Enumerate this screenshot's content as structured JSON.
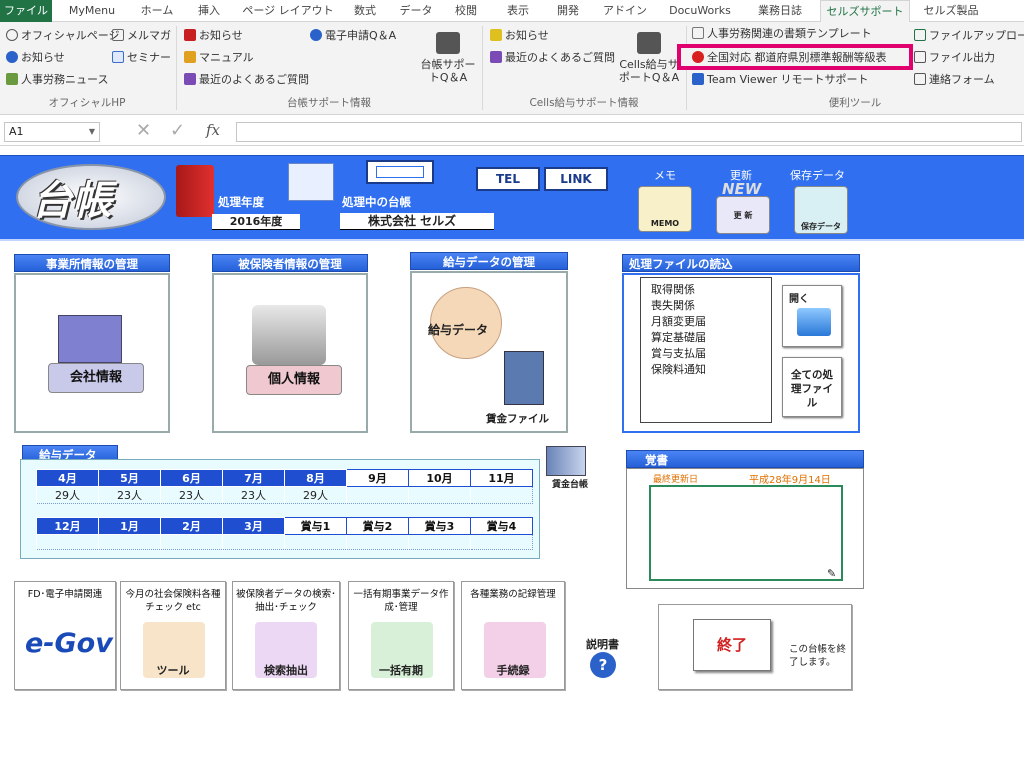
{
  "ribbon": {
    "tabs": [
      "ファイル",
      "MyMenu",
      "ホーム",
      "挿入",
      "ページ レイアウト",
      "数式",
      "データ",
      "校閲",
      "表示",
      "開発",
      "アドイン",
      "DocuWorks",
      "業務日誌",
      "セルズサポート",
      "セルズ製品"
    ],
    "official": {
      "items": [
        "オフィシャルページ",
        "お知らせ",
        "人事労務ニュース",
        "メルマガ",
        "セミナー"
      ],
      "group": "オフィシャルHP"
    },
    "daicho_support": {
      "items": [
        "お知らせ",
        "マニュアル",
        "最近のよくあるご質問",
        "電子申請Q＆A",
        "台帳サポートQ＆A"
      ],
      "group": "台帳サポート情報"
    },
    "cells_support": {
      "items": [
        "お知らせ",
        "最近のよくあるご質問",
        "Cells給与サポートQ＆A"
      ],
      "group": "Cells給与サポート情報"
    },
    "tools": {
      "items": [
        "人事労務関連の書類テンプレート",
        "全国対応 都道府県別標準報酬等級表",
        "Team Viewer リモートサポート",
        "ファイルアップロード",
        "ファイル出力",
        "連絡フォーム"
      ],
      "group": "便利ツール"
    }
  },
  "formula": {
    "cell": "A1",
    "cancel": "✕",
    "enter": "✓",
    "fx": "fx"
  },
  "banner": {
    "logo": "台帳",
    "year_label": "処理年度",
    "year_value": "2016年度",
    "current_label": "処理中の台帳",
    "company": "株式会社 セルズ",
    "tel": "TEL",
    "link": "LINK",
    "memo_label": "メモ",
    "memo_btn": "MEMO",
    "update_label": "更新",
    "update_badge": "NEW",
    "update_btn": "更 新",
    "save_label": "保存データ",
    "save_btn": "保存データ"
  },
  "panels": {
    "company": {
      "title": "事業所情報の管理",
      "button": "会社情報"
    },
    "insured": {
      "title": "被保険者情報の管理",
      "button": "個人情報"
    },
    "salary": {
      "title": "給与データの管理",
      "button": "給与データ",
      "file": "賃金ファイル"
    },
    "files": {
      "title": "処理ファイルの読込",
      "items": [
        "取得関係",
        "喪失関係",
        "月額変更届",
        "算定基礎届",
        "賞与支払届",
        "保険料通知"
      ],
      "open": "開く",
      "all": "全ての処理ファイル"
    }
  },
  "salary_table": {
    "title": "給与データ",
    "row1": [
      "4月",
      "5月",
      "6月",
      "7月",
      "8月",
      "9月",
      "10月",
      "11月"
    ],
    "row1_values": [
      "29人",
      "23人",
      "23人",
      "23人",
      "29人",
      "",
      "",
      ""
    ],
    "row2": [
      "12月",
      "1月",
      "2月",
      "3月",
      "賞与1",
      "賞与2",
      "賞与3",
      "賞与4"
    ],
    "ledger": "賃金台帳"
  },
  "memo": {
    "title": "覚書",
    "updated_label": "最終更新日",
    "updated_value": "平成28年9月14日"
  },
  "tools": [
    {
      "caption": "FD･電子申請関連",
      "label": "e-Gov"
    },
    {
      "caption": "今月の社会保険料各種チェック etc",
      "label": "ツール"
    },
    {
      "caption": "被保険者データの検索･抽出･チェック",
      "label": "検索抽出"
    },
    {
      "caption": "一括有期事業データ作成･管理",
      "label": "一括有期"
    },
    {
      "caption": "各種業務の記録管理",
      "label": "手続録"
    }
  ],
  "manual": "説明書",
  "exit": {
    "button": "終了",
    "note": "この台帳を終了します。"
  },
  "colors": {
    "excel_green": "#217346",
    "banner_blue": "#2f6ff0",
    "highlight": "#e0006e"
  }
}
